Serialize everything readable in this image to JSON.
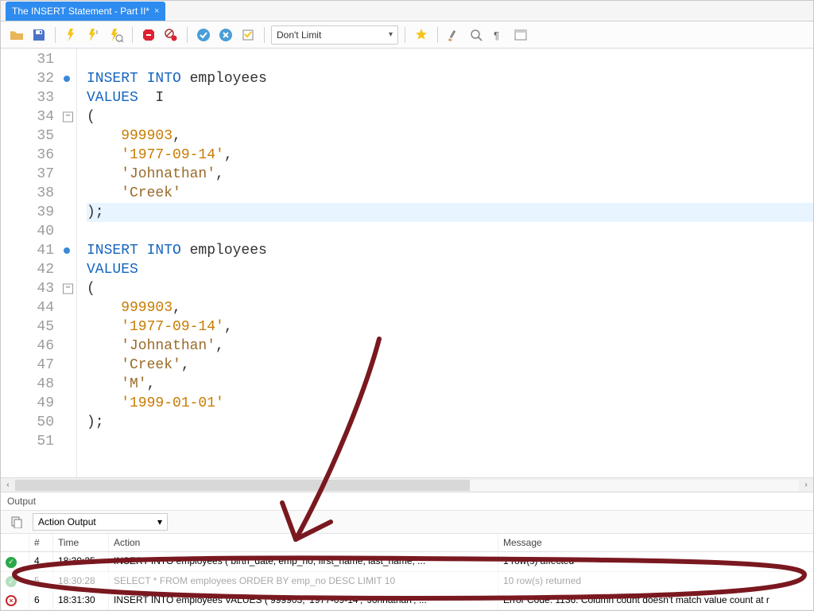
{
  "tab": {
    "title": "The INSERT Statement - Part II*"
  },
  "toolbar": {
    "limit_label": "Don't Limit"
  },
  "editor": {
    "lines": [
      {
        "n": 31,
        "segs": []
      },
      {
        "n": 32,
        "dot": true,
        "segs": [
          {
            "t": "INSERT INTO ",
            "c": "kw"
          },
          {
            "t": "employees",
            "c": "id"
          }
        ]
      },
      {
        "n": 33,
        "segs": [
          {
            "t": "VALUES",
            "c": "kw"
          }
        ],
        "cursorAfter": true
      },
      {
        "n": 34,
        "fold": true,
        "segs": [
          {
            "t": "(",
            "c": "id"
          }
        ]
      },
      {
        "n": 35,
        "segs": [
          {
            "t": "    999903",
            "c": "num"
          },
          {
            "t": ",",
            "c": "id"
          }
        ]
      },
      {
        "n": 36,
        "segs": [
          {
            "t": "    '1977-09-14'",
            "c": "str"
          },
          {
            "t": ",",
            "c": "id"
          }
        ]
      },
      {
        "n": 37,
        "segs": [
          {
            "t": "    'Johnathan'",
            "c": "str2"
          },
          {
            "t": ",",
            "c": "id"
          }
        ]
      },
      {
        "n": 38,
        "segs": [
          {
            "t": "    'Creek'",
            "c": "str2"
          }
        ]
      },
      {
        "n": 39,
        "hl": true,
        "segs": [
          {
            "t": ");",
            "c": "id"
          }
        ]
      },
      {
        "n": 40,
        "segs": []
      },
      {
        "n": 41,
        "dot": true,
        "segs": [
          {
            "t": "INSERT INTO ",
            "c": "kw"
          },
          {
            "t": "employees",
            "c": "id"
          }
        ]
      },
      {
        "n": 42,
        "segs": [
          {
            "t": "VALUES",
            "c": "kw"
          }
        ]
      },
      {
        "n": 43,
        "fold": true,
        "segs": [
          {
            "t": "(",
            "c": "id"
          }
        ]
      },
      {
        "n": 44,
        "segs": [
          {
            "t": "    999903",
            "c": "num"
          },
          {
            "t": ",",
            "c": "id"
          }
        ]
      },
      {
        "n": 45,
        "segs": [
          {
            "t": "    '1977-09-14'",
            "c": "str"
          },
          {
            "t": ",",
            "c": "id"
          }
        ]
      },
      {
        "n": 46,
        "segs": [
          {
            "t": "    'Johnathan'",
            "c": "str2"
          },
          {
            "t": ",",
            "c": "id"
          }
        ]
      },
      {
        "n": 47,
        "segs": [
          {
            "t": "    'Creek'",
            "c": "str2"
          },
          {
            "t": ",",
            "c": "id"
          }
        ]
      },
      {
        "n": 48,
        "segs": [
          {
            "t": "    'M'",
            "c": "str2"
          },
          {
            "t": ",",
            "c": "id"
          }
        ]
      },
      {
        "n": 49,
        "segs": [
          {
            "t": "    '1999-01-01'",
            "c": "str"
          }
        ]
      },
      {
        "n": 50,
        "segs": [
          {
            "t": ");",
            "c": "id"
          }
        ]
      },
      {
        "n": 51,
        "segs": []
      }
    ]
  },
  "output": {
    "panel_label": "Output",
    "selector": "Action Output",
    "columns": {
      "status": "",
      "num": "#",
      "time": "Time",
      "action": "Action",
      "message": "Message"
    },
    "rows": [
      {
        "status": "ok",
        "num": "4",
        "time": "18:30:25",
        "action": "INSERT INTO employees ( birth_date,    emp_no,    first_name,    last_name,    ...",
        "message": "1 row(s) affected"
      },
      {
        "status": "ok",
        "num": "5",
        "time": "18:30:28",
        "action": "SELECT   * FROM   employees ORDER BY emp_no DESC LIMIT 10",
        "message": "10 row(s) returned",
        "fade": true
      },
      {
        "status": "err",
        "num": "6",
        "time": "18:31:30",
        "action": "INSERT INTO employees VALUES (  999903,     '1977-09-14',     'Johnathan',    ...",
        "message": "Error Code: 1136. Column count doesn't match value count at r"
      }
    ]
  }
}
